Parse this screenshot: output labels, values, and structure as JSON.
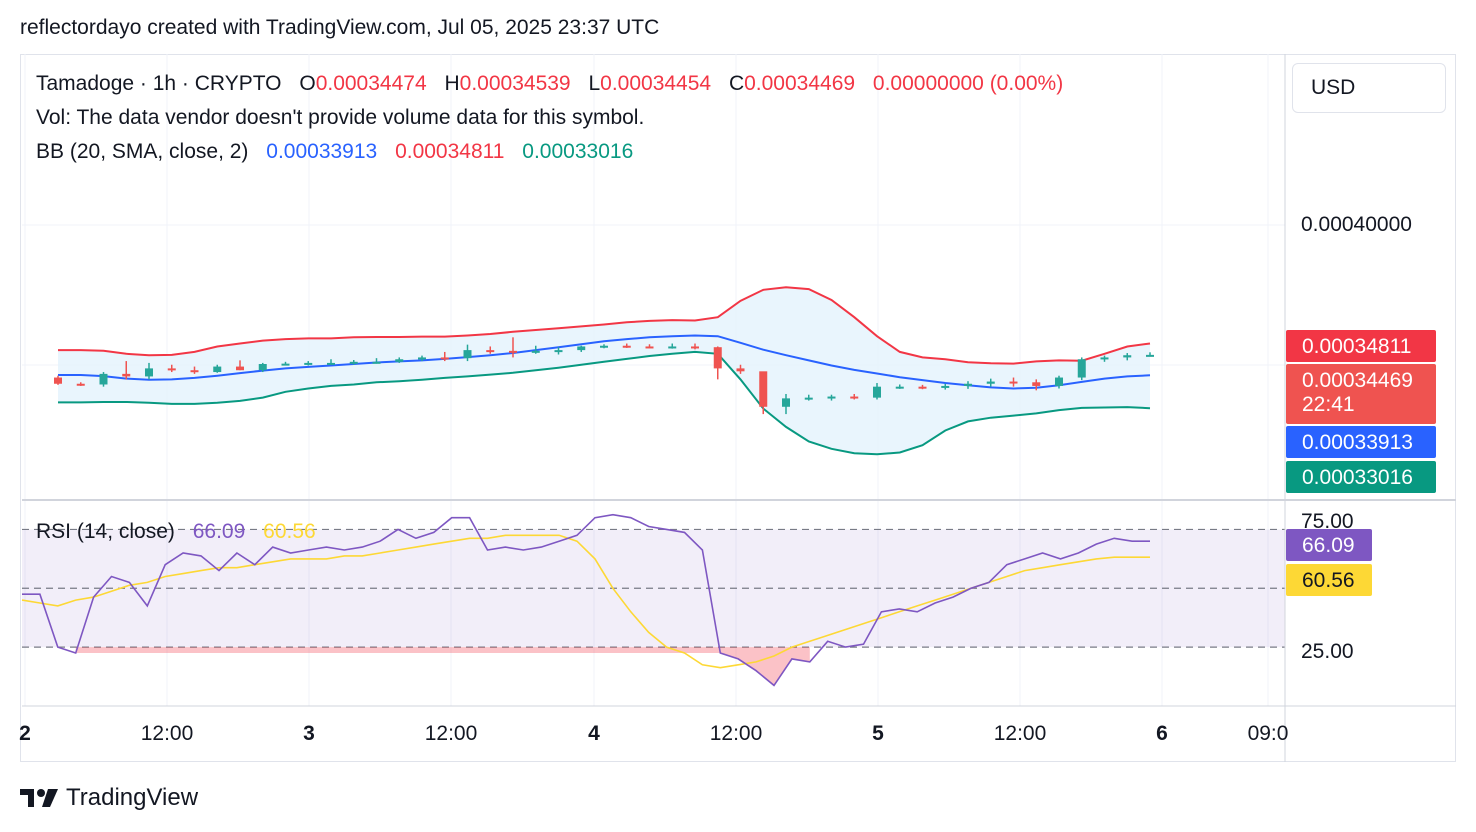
{
  "header": {
    "text": "reflectordayo created with TradingView.com, Jul 05, 2025 23:37 UTC"
  },
  "legend": {
    "symbol": "Tamadoge · 1h · CRYPTO",
    "o_label": "O",
    "o_value": "0.00034474",
    "h_label": "H",
    "h_value": "0.00034539",
    "l_label": "L",
    "l_value": "0.00034454",
    "c_label": "C",
    "c_value": "0.00034469",
    "change": "0.00000000 (0.00%)",
    "vol_text": "Vol: The data vendor doesn't provide volume data for this symbol.",
    "bb_label": "BB (20, SMA, close, 2)",
    "bb_basis": "0.00033913",
    "bb_upper": "0.00034811",
    "bb_lower": "0.00033016",
    "rsi_label": "RSI (14, close)",
    "rsi_value": "66.09",
    "rsi_ma_value": "60.56"
  },
  "price_axis": {
    "currency": "USD",
    "grid_label": "0.00040000",
    "tags": {
      "upper": "0.00034811",
      "last": "0.00034469",
      "countdown": "22:41",
      "basis": "0.00033913",
      "lower": "0.00033016"
    }
  },
  "rsi_axis": {
    "tick_high": "75.00",
    "tick_low": "25.00",
    "value_tag": "66.09",
    "ma_tag": "60.56"
  },
  "time_axis": {
    "ticks": [
      "2",
      "12:00",
      "3",
      "12:00",
      "4",
      "12:00",
      "5",
      "12:00",
      "6",
      "09:0"
    ]
  },
  "brand": {
    "name": "TradingView"
  },
  "colors": {
    "up": "#26a69a",
    "down": "#ef5350",
    "basis": "#2962ff",
    "upper": "#f23645",
    "lower": "#089981",
    "rsi": "#7e57c2",
    "rsi_ma": "#fdd835",
    "band_fill": "#e3f2fd"
  },
  "chart_data": [
    {
      "type": "candlestick",
      "title": "Tamadoge · 1h · CRYPTO",
      "ylim": [
        0.000305,
        0.000427
      ],
      "x_ticks": [
        "2",
        "12:00",
        "3",
        "12:00",
        "4",
        "12:00",
        "5",
        "12:00",
        "6",
        "09:0"
      ],
      "series": [
        {
          "name": "BB upper",
          "values": [
            0.000346,
            0.000346,
            0.0003458,
            0.000345,
            0.0003446,
            0.0003447,
            0.0003455,
            0.000347,
            0.0003478,
            0.0003486,
            0.000349,
            0.0003492,
            0.0003492,
            0.0003495,
            0.0003496,
            0.0003496,
            0.0003497,
            0.0003497,
            0.00035,
            0.0003504,
            0.000351,
            0.0003515,
            0.000352,
            0.0003525,
            0.000353,
            0.0003536,
            0.000354,
            0.0003542,
            0.0003541,
            0.000355,
            0.0003595,
            0.0003625,
            0.0003632,
            0.0003627,
            0.0003597,
            0.000355,
            0.0003498,
            0.0003455,
            0.000344,
            0.0003435,
            0.0003427,
            0.0003424,
            0.0003423,
            0.0003429,
            0.0003432,
            0.0003431,
            0.000345,
            0.000347,
            0.0003478
          ]
        },
        {
          "name": "BB basis",
          "values": [
            0.0003392,
            0.0003392,
            0.0003389,
            0.0003382,
            0.0003379,
            0.000338,
            0.0003384,
            0.000339,
            0.0003397,
            0.0003404,
            0.000341,
            0.0003414,
            0.0003418,
            0.0003422,
            0.0003426,
            0.0003429,
            0.0003432,
            0.0003436,
            0.0003441,
            0.0003446,
            0.0003452,
            0.000346,
            0.0003468,
            0.0003476,
            0.0003484,
            0.000349,
            0.0003495,
            0.0003498,
            0.00035,
            0.0003498,
            0.000348,
            0.0003461,
            0.0003446,
            0.0003432,
            0.0003418,
            0.0003406,
            0.0003396,
            0.0003386,
            0.0003378,
            0.000337,
            0.0003364,
            0.0003358,
            0.0003355,
            0.0003357,
            0.0003364,
            0.0003373,
            0.0003382,
            0.0003388,
            0.0003391
          ]
        },
        {
          "name": "BB lower",
          "values": [
            0.0003317,
            0.0003317,
            0.0003318,
            0.0003318,
            0.0003316,
            0.0003313,
            0.0003313,
            0.0003316,
            0.0003321,
            0.000333,
            0.0003346,
            0.0003355,
            0.0003362,
            0.0003366,
            0.0003372,
            0.0003375,
            0.0003379,
            0.0003384,
            0.0003388,
            0.0003393,
            0.0003398,
            0.0003405,
            0.0003412,
            0.000342,
            0.0003428,
            0.0003436,
            0.0003444,
            0.000345,
            0.0003455,
            0.000345,
            0.000338,
            0.00033,
            0.000325,
            0.000321,
            0.000319,
            0.0003178,
            0.0003175,
            0.000318,
            0.00032,
            0.000324,
            0.0003265,
            0.0003275,
            0.0003281,
            0.0003287,
            0.0003296,
            0.0003302,
            0.0003303,
            0.0003304,
            0.0003301
          ]
        },
        {
          "name": "Candles",
          "values": [
            [
              0.0003385,
              0.000339,
              0.0003365,
              0.0003368
            ],
            [
              0.0003368,
              0.0003372,
              0.0003362,
              0.0003366
            ],
            [
              0.0003366,
              0.00034,
              0.000336,
              0.0003395
            ],
            [
              0.0003395,
              0.000343,
              0.000338,
              0.0003388
            ],
            [
              0.0003388,
              0.0003425,
              0.000338,
              0.000341
            ],
            [
              0.000341,
              0.000342,
              0.00034,
              0.0003405
            ],
            [
              0.0003405,
              0.0003415,
              0.0003395,
              0.00034
            ],
            [
              0.00034,
              0.000342,
              0.0003398,
              0.0003415
            ],
            [
              0.0003415,
              0.0003432,
              0.0003405,
              0.0003405
            ],
            [
              0.0003405,
              0.0003425,
              0.00034,
              0.0003422
            ],
            [
              0.0003422,
              0.0003428,
              0.0003418,
              0.0003423
            ],
            [
              0.0003423,
              0.000343,
              0.0003418,
              0.0003425
            ],
            [
              0.0003425,
              0.0003435,
              0.000342,
              0.0003425
            ],
            [
              0.0003425,
              0.0003433,
              0.000342,
              0.0003428
            ],
            [
              0.0003428,
              0.0003438,
              0.0003423,
              0.0003428
            ],
            [
              0.0003428,
              0.000344,
              0.0003425,
              0.0003435
            ],
            [
              0.0003435,
              0.0003445,
              0.000343,
              0.000344
            ],
            [
              0.000344,
              0.0003455,
              0.000343,
              0.0003438
            ],
            [
              0.0003438,
              0.0003475,
              0.000343,
              0.000346
            ],
            [
              0.000346,
              0.000347,
              0.000345,
              0.0003458
            ],
            [
              0.0003458,
              0.0003495,
              0.000344,
              0.0003455
            ],
            [
              0.0003455,
              0.0003472,
              0.000345,
              0.0003458
            ],
            [
              0.0003458,
              0.0003468,
              0.0003448,
              0.000346
            ],
            [
              0.000346,
              0.0003472,
              0.0003455,
              0.000347
            ],
            [
              0.000347,
              0.0003476,
              0.0003465,
              0.0003472
            ],
            [
              0.0003472,
              0.0003478,
              0.0003466,
              0.000347
            ],
            [
              0.000347,
              0.0003476,
              0.0003465,
              0.0003468
            ],
            [
              0.0003468,
              0.0003478,
              0.0003464,
              0.000347
            ],
            [
              0.000347,
              0.0003478,
              0.0003462,
              0.0003468
            ],
            [
              0.0003468,
              0.000347,
              0.000338,
              0.000341
            ],
            [
              0.000341,
              0.000342,
              0.0003395,
              0.0003402
            ],
            [
              0.0003402,
              0.0003395,
              0.0003285,
              0.0003305
            ],
            [
              0.0003305,
              0.000334,
              0.0003285,
              0.0003328
            ],
            [
              0.0003328,
              0.0003338,
              0.0003322,
              0.000333
            ],
            [
              0.000333,
              0.0003338,
              0.0003322,
              0.0003333
            ],
            [
              0.0003333,
              0.000334,
              0.0003325,
              0.000333
            ],
            [
              0.000333,
              0.000337,
              0.0003325,
              0.000336
            ],
            [
              0.000336,
              0.0003366,
              0.0003354,
              0.000336
            ],
            [
              0.000336,
              0.0003365,
              0.0003353,
              0.0003358
            ],
            [
              0.0003358,
              0.0003368,
              0.0003352,
              0.0003362
            ],
            [
              0.0003362,
              0.0003375,
              0.0003354,
              0.0003368
            ],
            [
              0.0003368,
              0.0003382,
              0.000336,
              0.0003374
            ],
            [
              0.0003374,
              0.0003385,
              0.000336,
              0.0003372
            ],
            [
              0.0003372,
              0.000338,
              0.000335,
              0.0003362
            ],
            [
              0.0003362,
              0.000339,
              0.0003355,
              0.0003385
            ],
            [
              0.0003385,
              0.000344,
              0.0003378,
              0.0003435
            ],
            [
              0.0003435,
              0.0003445,
              0.0003428,
              0.000344
            ],
            [
              0.000344,
              0.0003452,
              0.0003432,
              0.0003446
            ],
            [
              0.0003447,
              0.0003454,
              0.0003445,
              0.0003447
            ]
          ]
        }
      ]
    },
    {
      "type": "line",
      "title": "RSI (14, close)",
      "ylim": [
        10,
        80
      ],
      "y_ticks": [
        25,
        75
      ],
      "bands": [
        30,
        50,
        70
      ],
      "series": [
        {
          "name": "RSI",
          "values": [
            48,
            48,
            30,
            28,
            47,
            54,
            52,
            44,
            58,
            62,
            61,
            56,
            62,
            58,
            64,
            62,
            63,
            64,
            63,
            64,
            66,
            70,
            67,
            69,
            74,
            74,
            63,
            64,
            63,
            64,
            66,
            68,
            74,
            75,
            74,
            71,
            70,
            69,
            63,
            28,
            26,
            22,
            17,
            26,
            25,
            32,
            30,
            31,
            42,
            43,
            42,
            45,
            47,
            50,
            52,
            58,
            60,
            62,
            60,
            62,
            65,
            67,
            66,
            66
          ]
        },
        {
          "name": "RSI MA",
          "values": [
            46,
            45,
            44,
            46,
            47,
            49,
            51,
            52,
            54,
            55,
            56,
            57,
            57,
            58,
            59,
            60,
            60,
            60,
            61,
            61,
            62,
            63,
            64,
            65,
            66,
            67,
            67,
            68,
            68,
            68,
            68,
            66,
            60,
            50,
            42,
            35,
            30,
            28,
            24,
            23,
            24,
            25,
            27,
            30,
            32,
            34,
            36,
            38,
            40,
            42,
            44,
            46,
            48,
            50,
            52,
            54,
            56,
            57,
            58,
            59,
            60,
            60.56,
            60.56,
            60.56
          ]
        }
      ]
    }
  ]
}
